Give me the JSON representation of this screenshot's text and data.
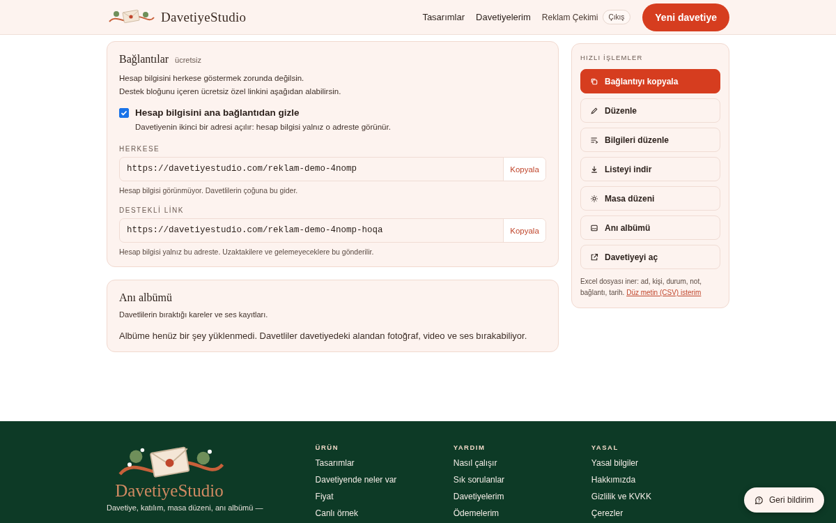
{
  "header": {
    "brand": "DavetiyeStudio",
    "nav": [
      {
        "label": "Tasarımlar"
      },
      {
        "label": "Davetiyelerim"
      }
    ],
    "user": "Reklam Çekimi",
    "logout": "Çıkış",
    "cta": "Yeni davetiye"
  },
  "links_card": {
    "title": "Bağlantılar",
    "badge": "ücretsiz",
    "intro": [
      "Hesap bilgisini herkese göstermek zorunda değilsin.",
      "Destek bloğunu içeren ücretsiz özel linkini aşağıdan alabilirsin."
    ],
    "option": {
      "label": "Hesap bilgisini ana bağlantıdan gizle",
      "hint": "Davetiyenin ikinci bir adresi açılır: hesap bilgisi yalnız o adreste görünür.",
      "checked": true
    },
    "fields": [
      {
        "label": "HERKESE",
        "url": "https://davetiyestudio.com/reklam-demo-4nomp",
        "button": "Kopyala",
        "note": "Hesap bilgisi görünmüyor. Davetlilerin çoğuna bu gider."
      },
      {
        "label": "DESTEKLİ LİNK",
        "url": "https://davetiyestudio.com/reklam-demo-4nomp-hoqa",
        "button": "Kopyala",
        "note": "Hesap bilgisi yalnız bu adreste. Uzaktakilere ve gelemeyeceklere bu gönderilir."
      }
    ]
  },
  "album_card": {
    "title": "Anı albümü",
    "subtitle": "Davetlilerin bıraktığı kareler ve ses kayıtları.",
    "empty": "Albüme henüz bir şey yüklenmedi. Davetliler davetiyedeki alandan fotoğraf, video ve ses bırakabiliyor."
  },
  "quick_actions": {
    "title": "HIZLI İŞLEMLER",
    "actions": [
      {
        "label": "Bağlantıyı kopyala",
        "kind": "primary"
      },
      {
        "label": "Düzenle",
        "kind": "normal"
      },
      {
        "label": "Bilgileri düzenle",
        "kind": "normal"
      },
      {
        "label": "Listeyi indir",
        "kind": "normal"
      },
      {
        "label": "Masa düzeni",
        "kind": "normal"
      },
      {
        "label": "Anı albümü",
        "kind": "normal"
      },
      {
        "label": "Davetiyeyi aç",
        "kind": "normal"
      }
    ],
    "note": "Excel dosyası iner: ad, kişi, durum, not, bağlantı, tarih.",
    "note_link": "Düz metin (CSV) isterim"
  },
  "footer": {
    "brand": "DavetiyeStudio",
    "tagline": "Davetiye, katılım, masa düzeni, anı albümü —",
    "columns": [
      {
        "title": "ÜRÜN",
        "links": [
          "Tasarımlar",
          "Davetiyende neler var",
          "Fiyat",
          "Canlı örnek"
        ]
      },
      {
        "title": "YARDIM",
        "links": [
          "Nasıl çalışır",
          "Sık sorulanlar",
          "Davetiyelerim",
          "Ödemelerim"
        ]
      },
      {
        "title": "YASAL",
        "links": [
          "Yasal bilgiler",
          "Hakkımızda",
          "Gizlilik ve KVKK",
          "Çerezler"
        ]
      }
    ]
  },
  "feedback": "Geri bildirim"
}
